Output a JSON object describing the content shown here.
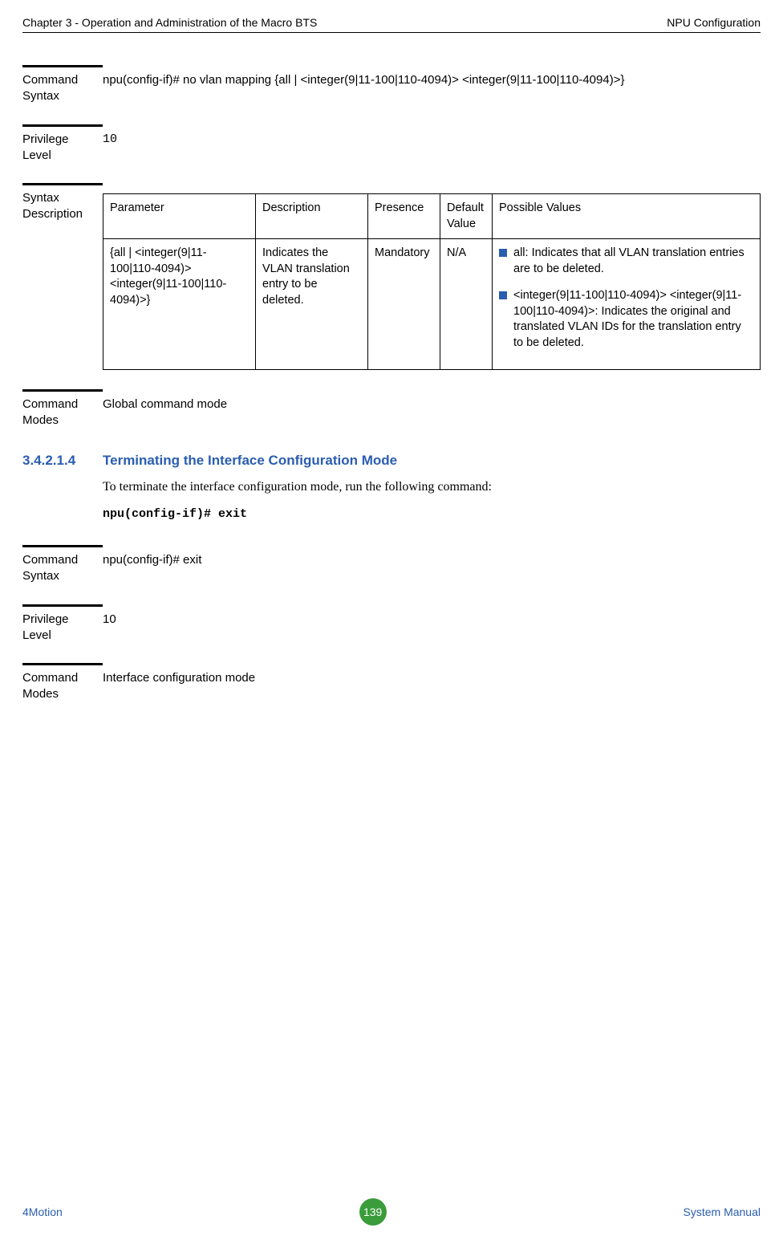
{
  "header": {
    "left": "Chapter 3 - Operation and Administration of the Macro BTS",
    "right": "NPU Configuration"
  },
  "s1": {
    "label": "Command Syntax",
    "value": "npu(config-if)# no vlan mapping {all | <integer(9|11-100|110-4094)> <integer(9|11-100|110-4094)>}"
  },
  "s2": {
    "label": "Privilege Level",
    "value": "10"
  },
  "s3": {
    "label": "Syntax Description",
    "table": {
      "headers": {
        "param": "Parameter",
        "desc": "Description",
        "pres": "Presence",
        "def": "Default Value",
        "poss": "Possible Values"
      },
      "row": {
        "param": "{all | <integer(9|11-100|110-4094)> <integer(9|11-100|110-4094)>}",
        "desc": "Indicates the VLAN translation entry to be deleted.",
        "pres": "Mandatory",
        "def": "N/A",
        "poss": {
          "b1": "all: Indicates that all VLAN translation entries are to be deleted.",
          "b2": "<integer(9|11-100|110-4094)> <integer(9|11-100|110-4094)>: Indicates the original and translated VLAN IDs for the translation entry to be deleted."
        }
      }
    }
  },
  "s4": {
    "label": "Command Modes",
    "value": "Global command mode"
  },
  "heading": {
    "num": "3.4.2.1.4",
    "title": "Terminating the Interface Configuration Mode"
  },
  "body": {
    "intro": "To terminate the interface configuration mode, run the following command:",
    "cmd": "npu(config-if)# exit"
  },
  "s5": {
    "label": "Command Syntax",
    "value": "npu(config-if)# exit"
  },
  "s6": {
    "label": "Privilege Level",
    "value": "10"
  },
  "s7": {
    "label": "Command Modes",
    "value": "Interface configuration mode"
  },
  "footer": {
    "left": "4Motion",
    "page": "139",
    "right": "System Manual"
  }
}
